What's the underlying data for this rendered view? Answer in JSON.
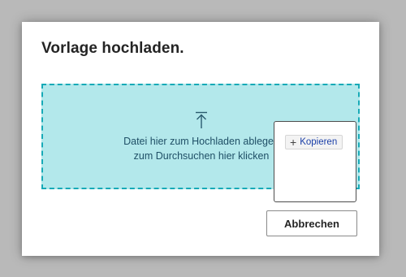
{
  "dialog": {
    "title": "Vorlage hochladen.",
    "dropzone": {
      "icon": "upload-arrow-icon",
      "line1": "Datei hier zum Hochladen ablegen",
      "line2": "zum Durchsuchen hier klicken"
    },
    "popup": {
      "copy_label": "Kopieren",
      "copy_icon": "plus-icon"
    },
    "cancel_label": "Abbrechen"
  },
  "colors": {
    "backdrop": "#b9b9b9",
    "dropzone_fill": "#b3e8eb",
    "dropzone_border": "#17aab7",
    "link_blue": "#1a3fa8"
  }
}
